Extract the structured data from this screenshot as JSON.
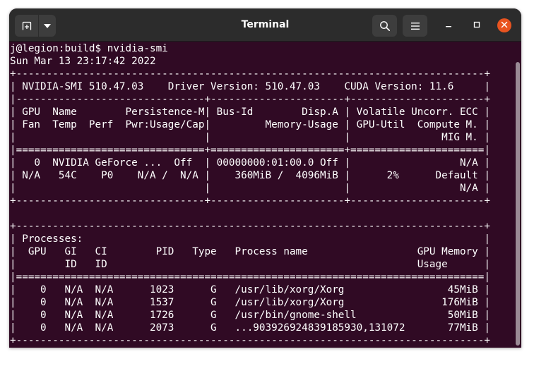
{
  "window": {
    "title": "Terminal",
    "colors": {
      "terminal_background": "#300a24",
      "titlebar_background": "#2c2c2c",
      "close_button": "#e95420",
      "text": "#ffffff"
    },
    "icons": {
      "new_tab": "new-tab-icon",
      "menu_dropdown": "chevron-down-icon",
      "search": "search-icon",
      "menu": "hamburger-menu-icon",
      "minimize": "minimize-icon",
      "maximize": "maximize-icon",
      "close": "close-icon"
    }
  },
  "terminal": {
    "lines": [
      "j@legion:build$ nvidia-smi",
      "Sun Mar 13 23:17:42 2022",
      "+-----------------------------------------------------------------------------+",
      "| NVIDIA-SMI 510.47.03    Driver Version: 510.47.03    CUDA Version: 11.6     |",
      "|-------------------------------+----------------------+----------------------+",
      "| GPU  Name        Persistence-M| Bus-Id        Disp.A | Volatile Uncorr. ECC |",
      "| Fan  Temp  Perf  Pwr:Usage/Cap|         Memory-Usage | GPU-Util  Compute M. |",
      "|                               |                      |               MIG M. |",
      "|===============================+======================+======================|",
      "|   0  NVIDIA GeForce ...  Off  | 00000000:01:00.0 Off |                  N/A |",
      "| N/A   54C    P0    N/A /  N/A |    360MiB /  4096MiB |      2%      Default |",
      "|                               |                      |                  N/A |",
      "+-------------------------------+----------------------+----------------------+",
      "",
      "+-----------------------------------------------------------------------------+",
      "| Processes:                                                                  |",
      "|  GPU   GI   CI        PID   Type   Process name                  GPU Memory |",
      "|        ID   ID                                                   Usage      |",
      "|=============================================================================|",
      "|    0   N/A  N/A      1023      G   /usr/lib/xorg/Xorg                 45MiB |",
      "|    0   N/A  N/A      1537      G   /usr/lib/xorg/Xorg                176MiB |",
      "|    0   N/A  N/A      1726      G   /usr/bin/gnome-shell               50MiB |",
      "|    0   N/A  N/A      2073      G   ...903926924839185930,131072       77MiB |",
      "+-----------------------------------------------------------------------------+"
    ]
  }
}
